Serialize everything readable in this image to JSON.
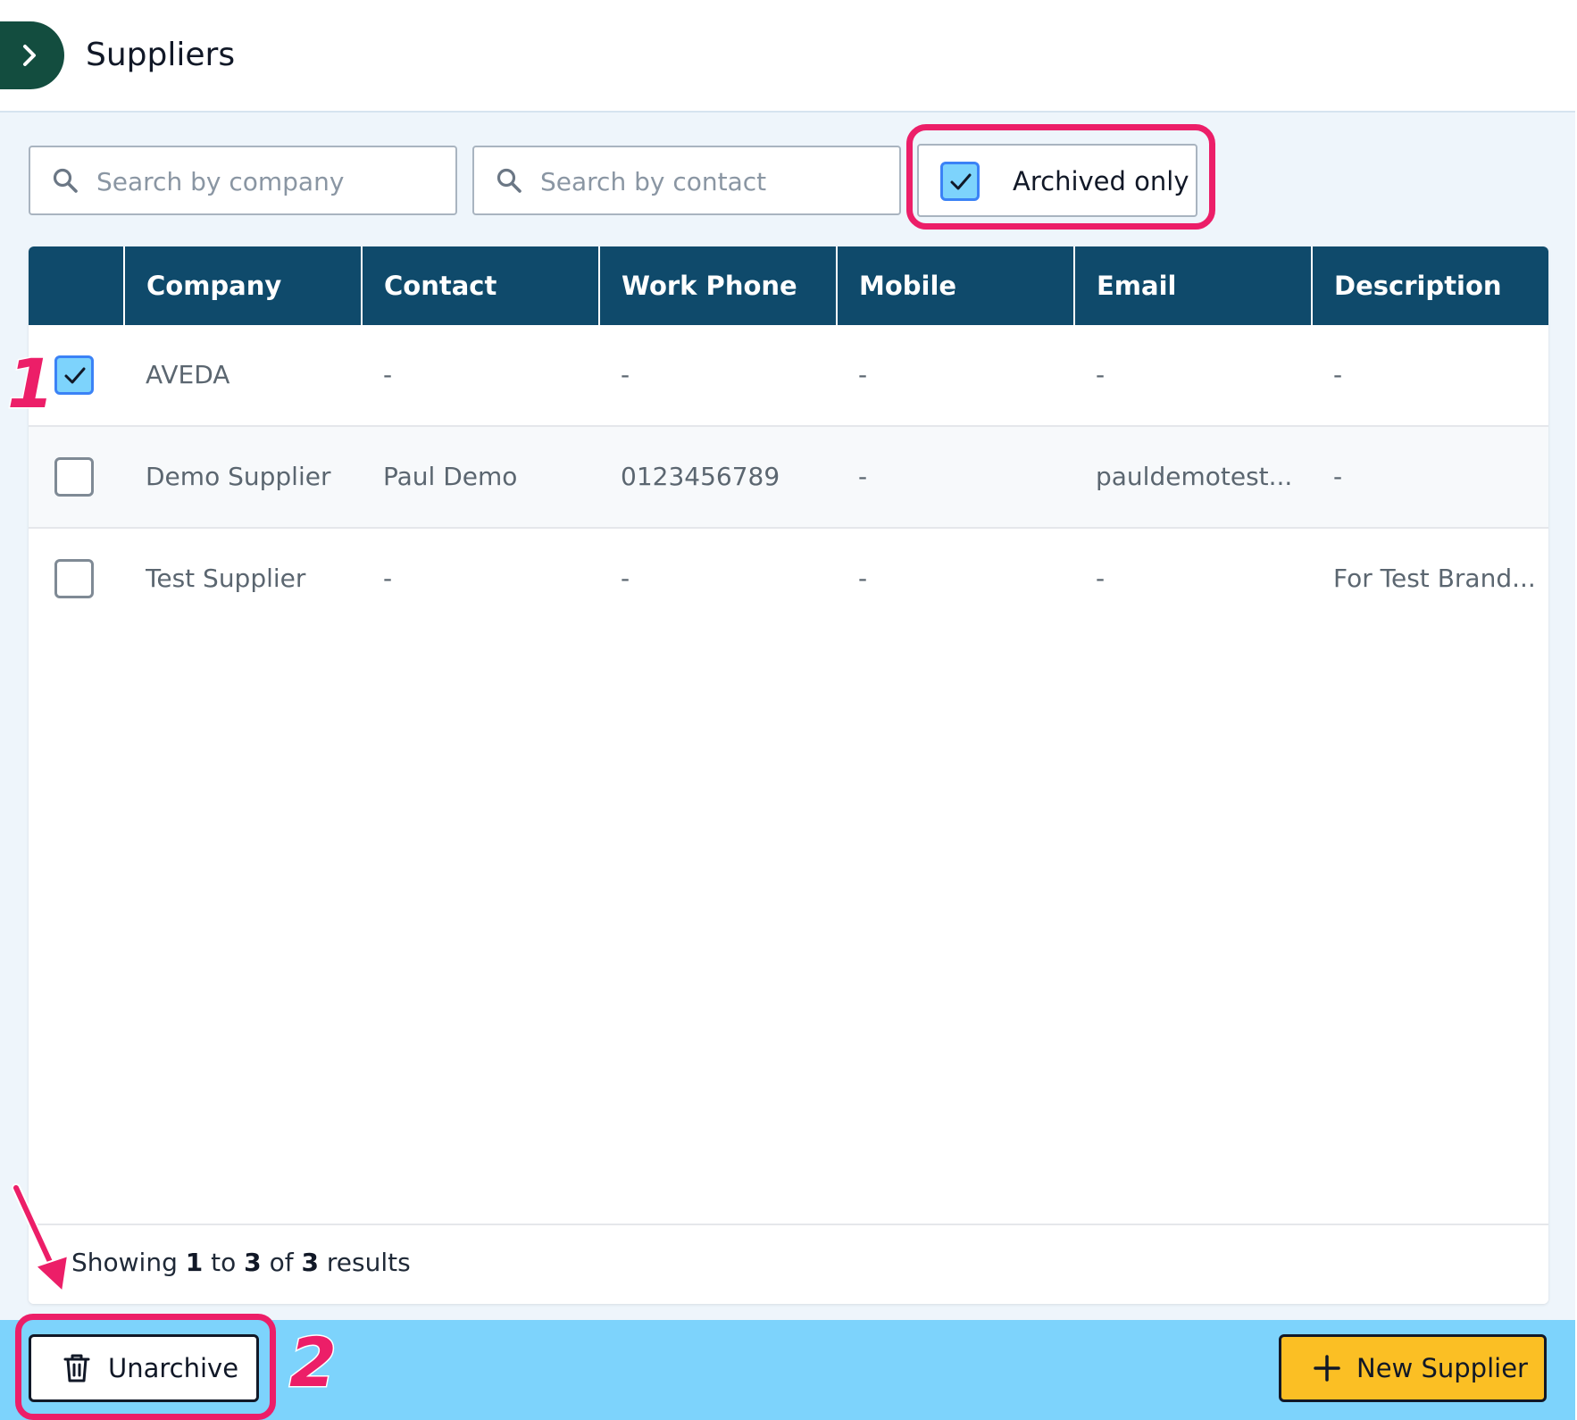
{
  "header": {
    "title": "Suppliers",
    "expand_icon": "chevron-right-icon"
  },
  "filters": {
    "company_search": {
      "placeholder": "Search by company",
      "value": ""
    },
    "contact_search": {
      "placeholder": "Search by contact",
      "value": ""
    },
    "archived_only": {
      "label": "Archived only",
      "checked": true
    }
  },
  "table": {
    "columns": [
      "Company",
      "Contact",
      "Work Phone",
      "Mobile",
      "Email",
      "Description"
    ],
    "rows": [
      {
        "selected": true,
        "company": "AVEDA",
        "contact": "-",
        "work_phone": "-",
        "mobile": "-",
        "email": "-",
        "description": "-"
      },
      {
        "selected": false,
        "company": "Demo Supplier",
        "contact": "Paul Demo",
        "work_phone": "0123456789",
        "mobile": "-",
        "email": "pauldemotest...",
        "description": "-"
      },
      {
        "selected": false,
        "company": "Test Supplier",
        "contact": "-",
        "work_phone": "-",
        "mobile": "-",
        "email": "-",
        "description": "For Test Brand..."
      }
    ]
  },
  "pagination": {
    "prefix": "Showing",
    "from": "1",
    "to_word": "to",
    "to": "3",
    "of_word": "of",
    "total": "3",
    "suffix": "results"
  },
  "actions": {
    "unarchive_label": "Unarchive",
    "unarchive_icon": "trash-icon",
    "new_supplier_label": "New Supplier",
    "new_supplier_icon": "plus-icon"
  },
  "annotations": {
    "step_1": "1",
    "step_2": "2"
  },
  "colors": {
    "header_dark": "#0f4a6b",
    "accent_green": "#134d3f",
    "bottom_bar": "#7dd3fc",
    "primary_button": "#fbbf24",
    "annotation": "#ec1e68"
  }
}
